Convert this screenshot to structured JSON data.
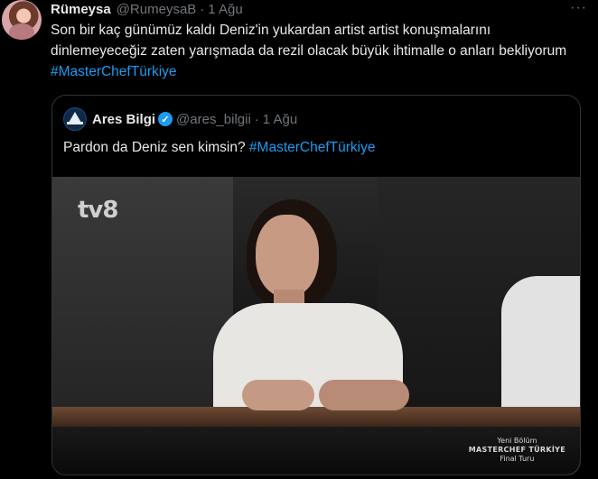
{
  "tweet": {
    "author_name": "Rümeysa",
    "author_handle": "@RumeysaB",
    "separator": "·",
    "date": "1 Ağu",
    "more_icon": "ellipsis-icon",
    "text": "Son bir kaç günümüz kaldı Deniz'in yukardan artist artist konuşmalarını dinlemeyeceğiz zaten yarışmada da rezil olacak büyük ihtimalle o anları bekliyorum ",
    "hashtag": "#MasterChefTürkiye"
  },
  "quoted_tweet": {
    "author_name": "Ares Bilgi",
    "author_handle": "@ares_bilgii",
    "separator": "·",
    "date": "1 Ağu",
    "verified_icon": "verified-badge-icon",
    "text": "Pardon da Deniz sen kimsin? ",
    "hashtag": "#MasterChefTürkiye",
    "media": {
      "channel_logo": "tv8",
      "overlay_line1": "Yeni Bölüm",
      "overlay_line2": "MASTERCHEF TÜRKİYE",
      "overlay_line3": "Final Turu"
    }
  },
  "colors": {
    "background": "#000000",
    "text": "#e7e9ea",
    "muted": "#71767b",
    "link": "#1d9bf0",
    "border": "#2f3336"
  }
}
